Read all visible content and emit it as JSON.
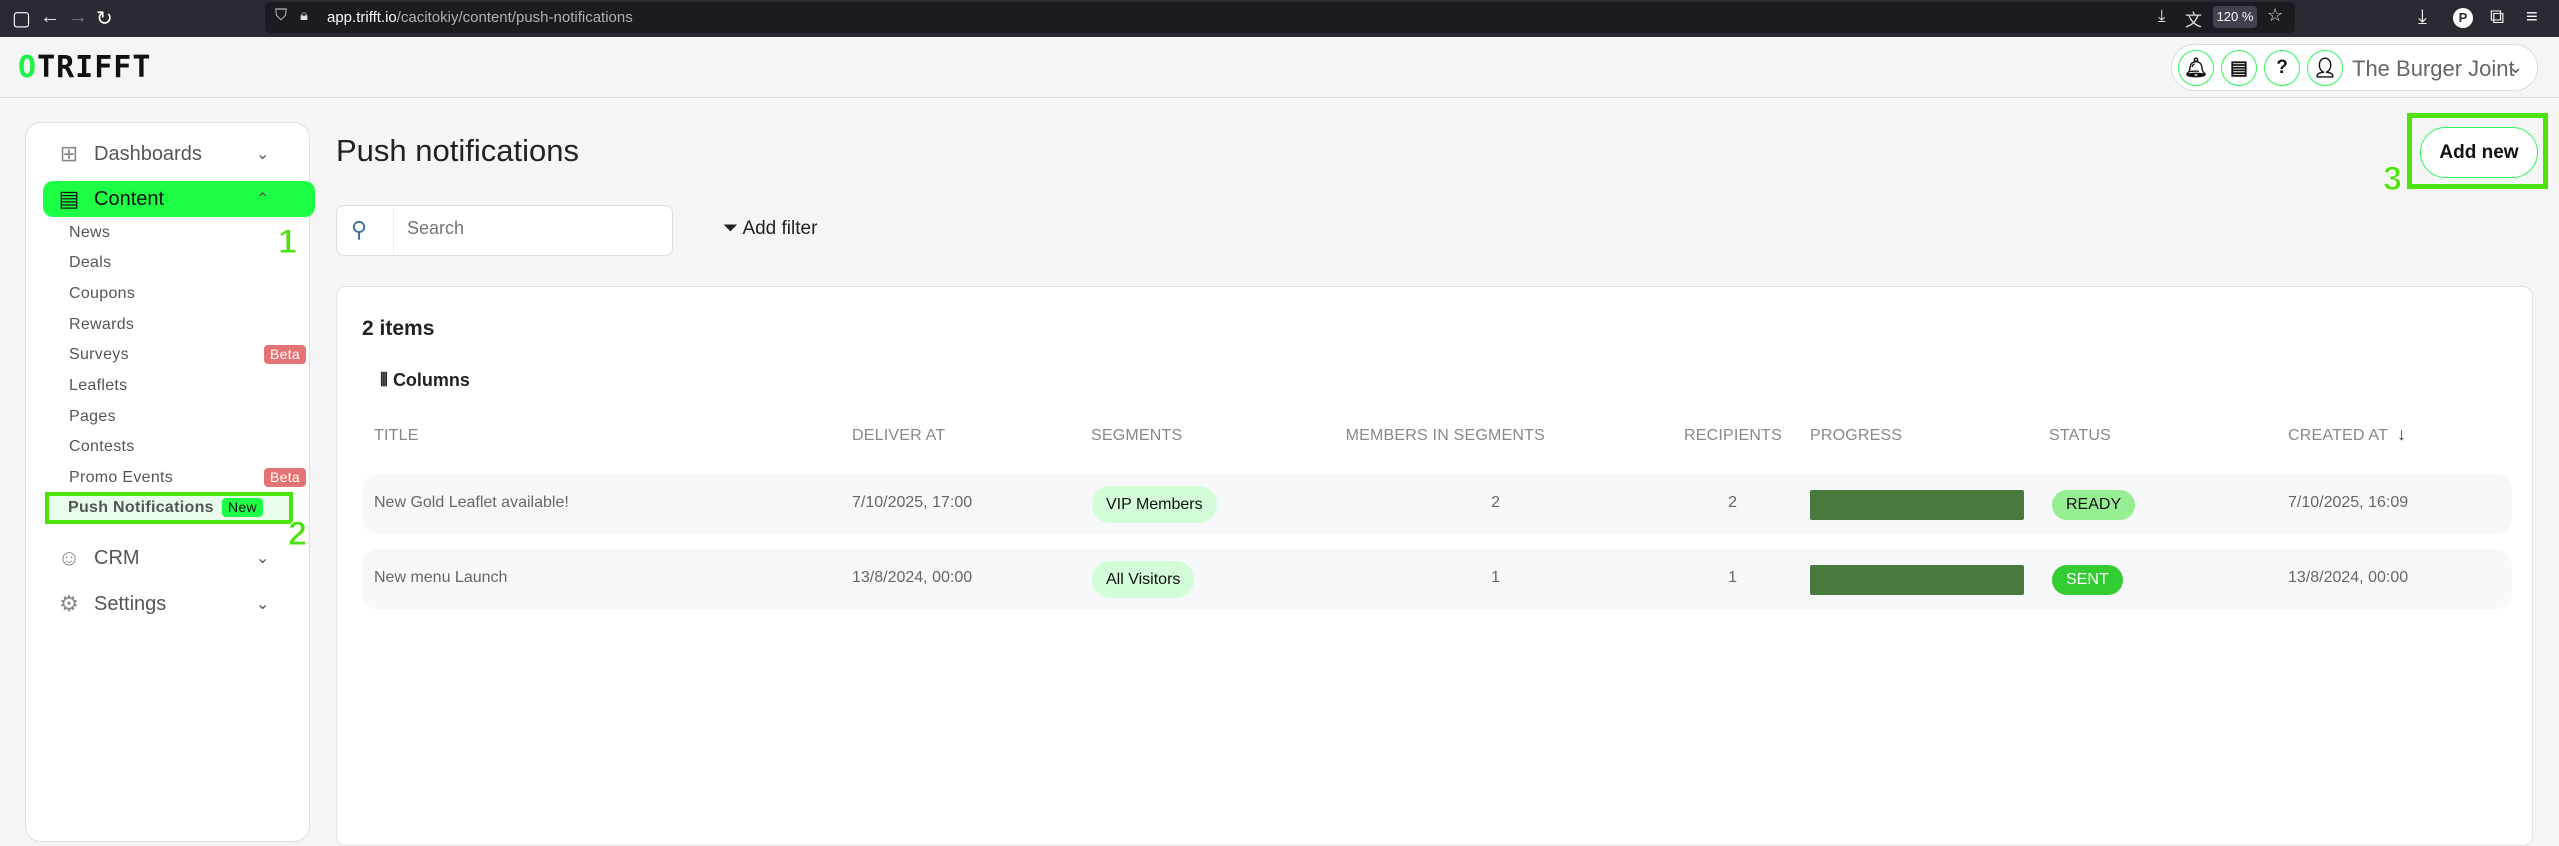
{
  "browser": {
    "url_domain": "app.trifft.io",
    "url_path": "/cacitokiy/content/push-notifications",
    "zoom": "120 %"
  },
  "header": {
    "logo": "TRIFFT",
    "user": "The Burger Joint"
  },
  "sidebar": {
    "dashboards": "Dashboards",
    "content": "Content",
    "items": [
      {
        "label": "News"
      },
      {
        "label": "Deals"
      },
      {
        "label": "Coupons"
      },
      {
        "label": "Rewards"
      },
      {
        "label": "Surveys",
        "badge": "Beta"
      },
      {
        "label": "Leaflets"
      },
      {
        "label": "Pages"
      },
      {
        "label": "Contests"
      },
      {
        "label": "Promo Events",
        "badge": "Beta"
      },
      {
        "label": "Push Notifications",
        "badge": "New"
      }
    ],
    "crm": "CRM",
    "settings": "Settings"
  },
  "annotations": [
    "1",
    "2",
    "3"
  ],
  "main": {
    "title": "Push notifications",
    "search_placeholder": "Search",
    "add_filter": "Add filter",
    "add_new": "Add new",
    "count": "2 items",
    "columns": "Columns",
    "headers": [
      "TITLE",
      "DELIVER AT",
      "SEGMENTS",
      "MEMBERS IN SEGMENTS",
      "RECIPIENTS",
      "PROGRESS",
      "STATUS",
      "CREATED AT"
    ],
    "sort": {
      "column": "CREATED AT",
      "direction": "descending"
    },
    "rows": [
      {
        "title": "New Gold Leaflet available!",
        "deliver_at": "7/10/2025, 17:00",
        "segment": "VIP Members",
        "members": "2",
        "recipients": "2",
        "progress": 100,
        "status": "READY",
        "status_color": "#96ee92",
        "created_at": "7/10/2025, 16:09"
      },
      {
        "title": "New menu Launch",
        "deliver_at": "13/8/2024, 00:00",
        "segment": "All Visitors",
        "members": "1",
        "recipients": "1",
        "progress": 100,
        "status": "SENT",
        "status_color": "#33cc33",
        "created_at": "13/8/2024, 00:00"
      }
    ]
  },
  "colors": {
    "accent": "#1cff44",
    "annotation": "#4be30a",
    "progress": "#487a3e"
  }
}
